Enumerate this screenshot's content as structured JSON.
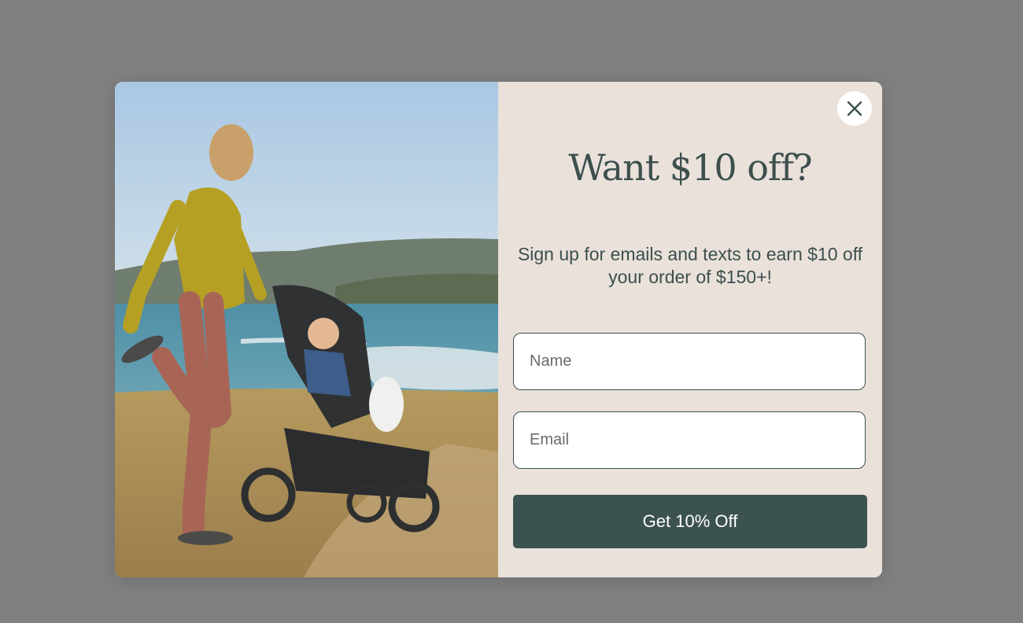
{
  "popup": {
    "headline": "Want $10 off?",
    "subtext": "Sign up for emails and texts to earn $10 off your order of $150+!",
    "name_placeholder": "Name",
    "email_placeholder": "Email",
    "submit_label": "Get 10% Off",
    "close_icon": "close-icon",
    "colors": {
      "panel_bg": "#e9e1da",
      "accent": "#3c5250",
      "text": "#3c4f4d",
      "backdrop": "#808080"
    }
  }
}
